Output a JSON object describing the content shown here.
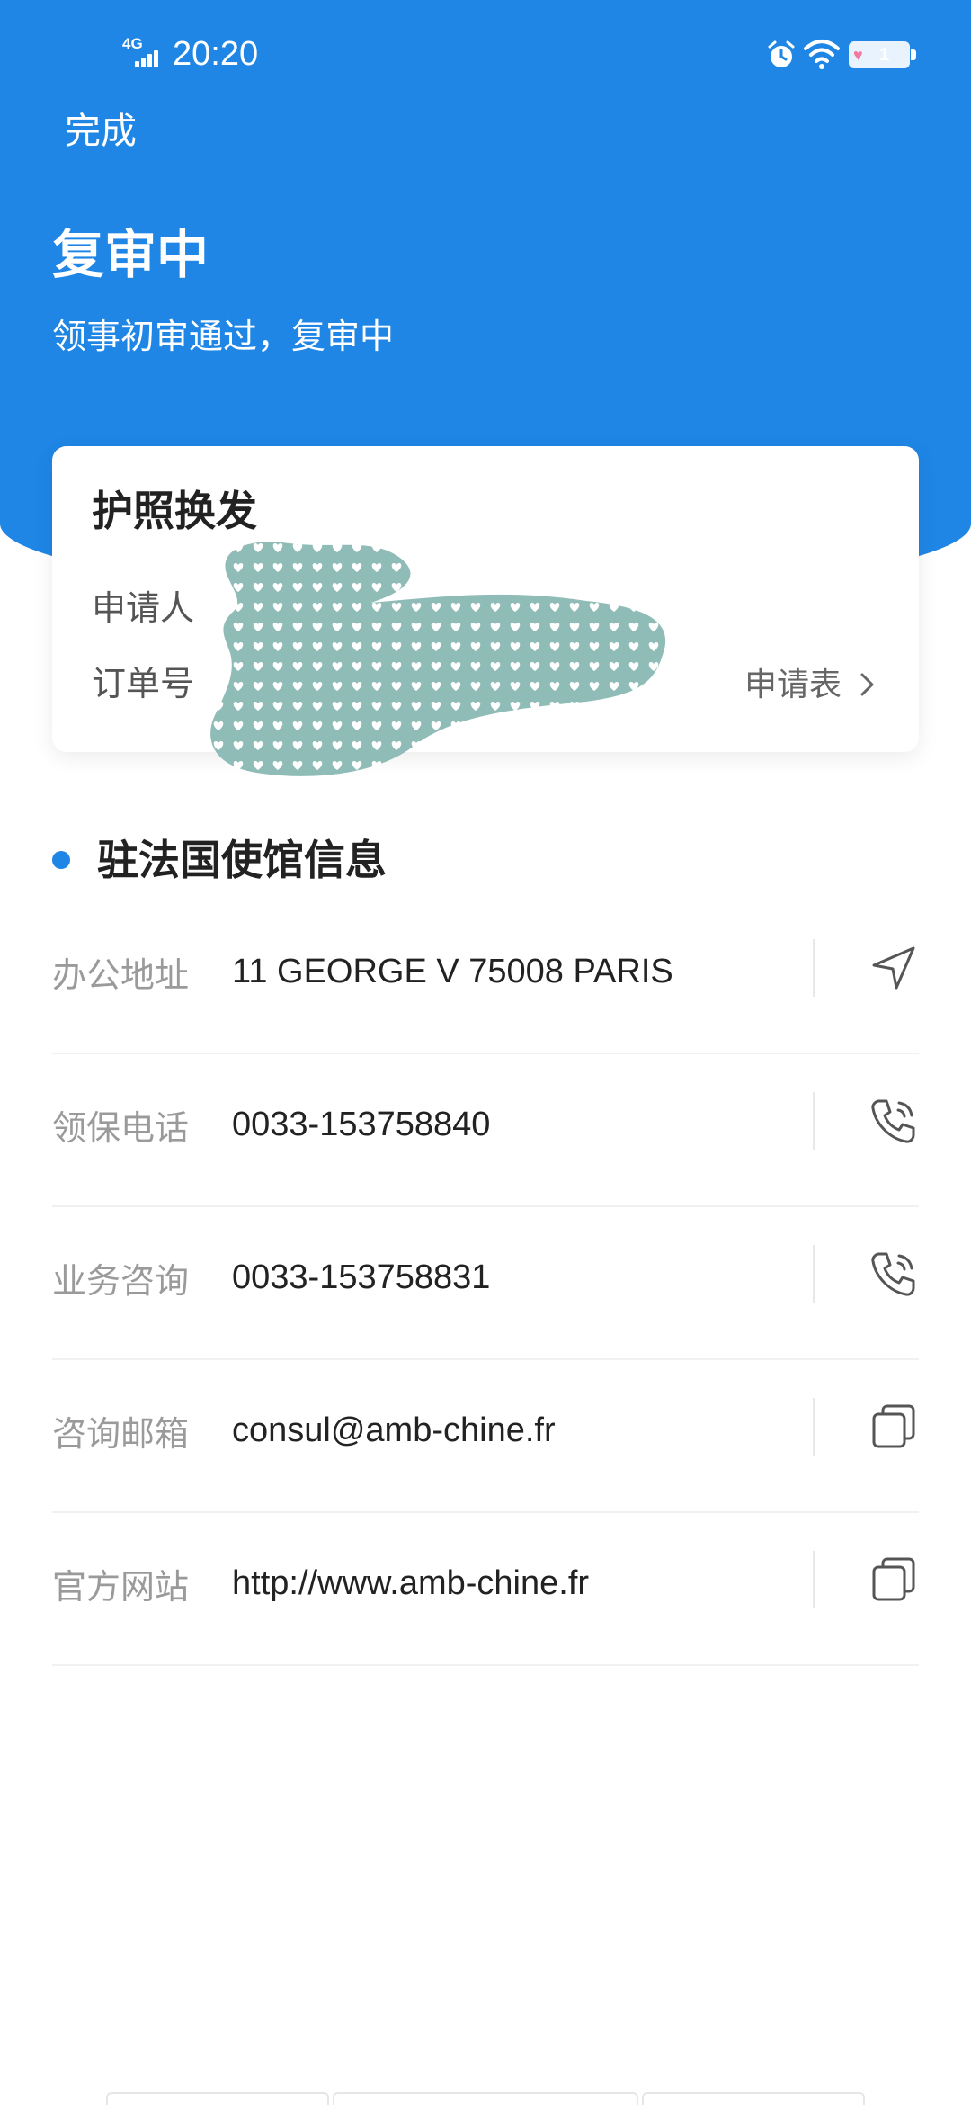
{
  "status_bar": {
    "network": "4G",
    "time": "20:20",
    "battery_level": "1"
  },
  "header": {
    "done_label": "完成",
    "title": "复审中",
    "subtitle": "领事初审通过，复审中"
  },
  "card": {
    "title": "护照换发",
    "applicant_label": "申请人",
    "order_label": "订单号",
    "form_link": "申请表"
  },
  "embassy": {
    "section_title": "驻法国使馆信息",
    "rows": [
      {
        "label": "办公地址",
        "value": "11 GEORGE V 75008 PARIS",
        "action_icon": "navigate-icon"
      },
      {
        "label": "领保电话",
        "value": "0033-153758840",
        "action_icon": "phone-icon"
      },
      {
        "label": "业务咨询",
        "value": "0033-153758831",
        "action_icon": "phone-icon"
      },
      {
        "label": "咨询邮箱",
        "value": "consul@amb-chine.fr",
        "action_icon": "copy-icon"
      },
      {
        "label": "官方网站",
        "value": "http://www.amb-chine.fr",
        "action_icon": "copy-icon"
      }
    ]
  },
  "colors": {
    "primary": "#1f86e5",
    "redaction": "#8fbcb7"
  }
}
